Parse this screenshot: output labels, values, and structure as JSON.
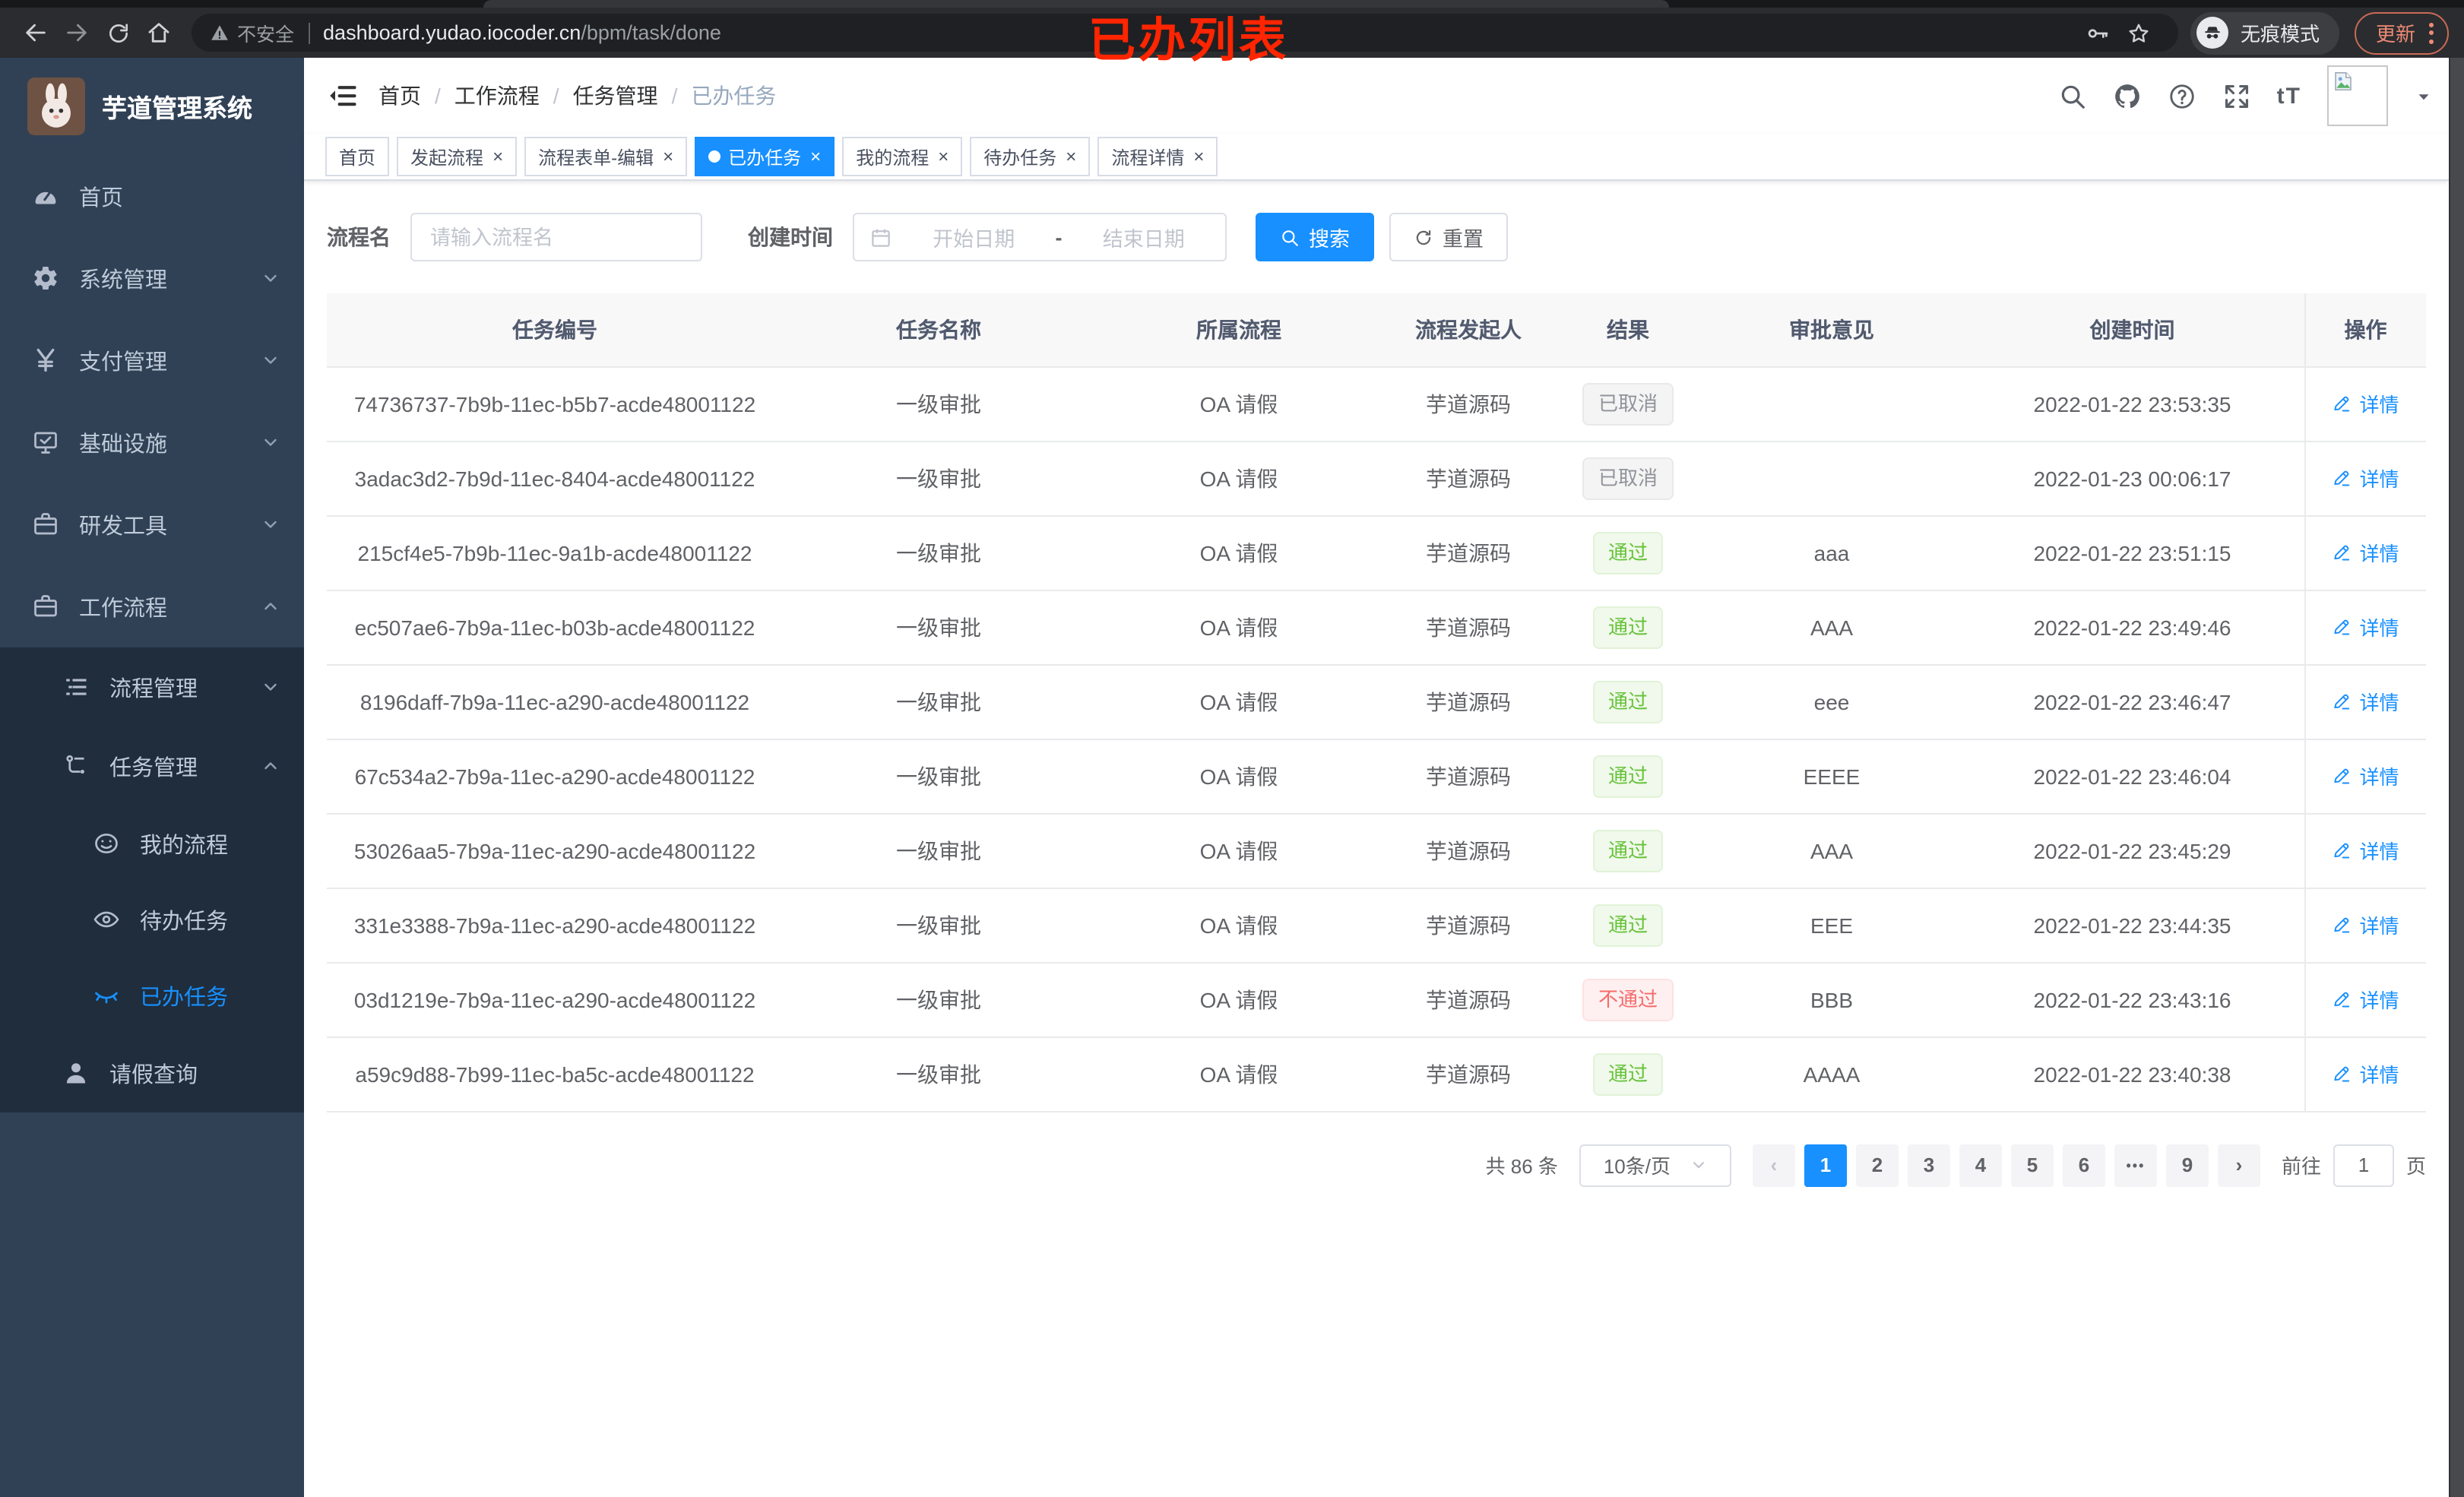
{
  "colors": {
    "accent": "#1890ff",
    "success": "#67c23a",
    "danger": "#f56c6c",
    "info": "#909399",
    "sidebar_bg": "#304156",
    "submenu_bg": "#1f2d3d",
    "annotation_red": "#fe2500"
  },
  "browser": {
    "annotation": "已办列表",
    "security_label": "不安全",
    "url_domain": "dashboard.yudao.iocoder.cn",
    "url_path": "/bpm/task/done",
    "incognito_label": "无痕模式",
    "update_label": "更新"
  },
  "sidebar": {
    "app_title": "芋道管理系统",
    "items": {
      "home": "首页",
      "system": "系统管理",
      "payment": "支付管理",
      "infra": "基础设施",
      "devtools": "研发工具",
      "workflow": "工作流程",
      "process_mgmt": "流程管理",
      "task_mgmt": "任务管理",
      "my_process": "我的流程",
      "todo_task": "待办任务",
      "done_task": "已办任务",
      "leave_query": "请假查询"
    }
  },
  "header": {
    "breadcrumb": [
      "首页",
      "工作流程",
      "任务管理",
      "已办任务"
    ],
    "separator": "/",
    "font_size_icon_label": "tT"
  },
  "tabs": {
    "close_glyph": "×",
    "items": [
      {
        "label": "首页"
      },
      {
        "label": "发起流程"
      },
      {
        "label": "流程表单-编辑"
      },
      {
        "label": "已办任务",
        "active": true
      },
      {
        "label": "我的流程"
      },
      {
        "label": "待办任务"
      },
      {
        "label": "流程详情"
      }
    ]
  },
  "filters": {
    "name_label": "流程名",
    "name_placeholder": "请输入流程名",
    "date_label": "创建时间",
    "date_start_placeholder": "开始日期",
    "date_separator": "-",
    "date_end_placeholder": "结束日期",
    "search_label": "搜索",
    "reset_label": "重置"
  },
  "table": {
    "columns": [
      "任务编号",
      "任务名称",
      "所属流程",
      "流程发起人",
      "结果",
      "审批意见",
      "创建时间",
      "操作"
    ],
    "rows": [
      {
        "id": "74736737-7b9b-11ec-b5b7-acde48001122",
        "name": "一级审批",
        "process": "OA 请假",
        "starter": "芋道源码",
        "result": "已取消",
        "result_type": "info",
        "opinion": "",
        "created": "2022-01-22 23:53:35",
        "action": "详情"
      },
      {
        "id": "3adac3d2-7b9d-11ec-8404-acde48001122",
        "name": "一级审批",
        "process": "OA 请假",
        "starter": "芋道源码",
        "result": "已取消",
        "result_type": "info",
        "opinion": "",
        "created": "2022-01-23 00:06:17",
        "action": "详情"
      },
      {
        "id": "215cf4e5-7b9b-11ec-9a1b-acde48001122",
        "name": "一级审批",
        "process": "OA 请假",
        "starter": "芋道源码",
        "result": "通过",
        "result_type": "success",
        "opinion": "aaa",
        "created": "2022-01-22 23:51:15",
        "action": "详情"
      },
      {
        "id": "ec507ae6-7b9a-11ec-b03b-acde48001122",
        "name": "一级审批",
        "process": "OA 请假",
        "starter": "芋道源码",
        "result": "通过",
        "result_type": "success",
        "opinion": "AAA",
        "created": "2022-01-22 23:49:46",
        "action": "详情"
      },
      {
        "id": "8196daff-7b9a-11ec-a290-acde48001122",
        "name": "一级审批",
        "process": "OA 请假",
        "starter": "芋道源码",
        "result": "通过",
        "result_type": "success",
        "opinion": "eee",
        "created": "2022-01-22 23:46:47",
        "action": "详情"
      },
      {
        "id": "67c534a2-7b9a-11ec-a290-acde48001122",
        "name": "一级审批",
        "process": "OA 请假",
        "starter": "芋道源码",
        "result": "通过",
        "result_type": "success",
        "opinion": "EEEE",
        "created": "2022-01-22 23:46:04",
        "action": "详情"
      },
      {
        "id": "53026aa5-7b9a-11ec-a290-acde48001122",
        "name": "一级审批",
        "process": "OA 请假",
        "starter": "芋道源码",
        "result": "通过",
        "result_type": "success",
        "opinion": "AAA",
        "created": "2022-01-22 23:45:29",
        "action": "详情"
      },
      {
        "id": "331e3388-7b9a-11ec-a290-acde48001122",
        "name": "一级审批",
        "process": "OA 请假",
        "starter": "芋道源码",
        "result": "通过",
        "result_type": "success",
        "opinion": "EEE",
        "created": "2022-01-22 23:44:35",
        "action": "详情"
      },
      {
        "id": "03d1219e-7b9a-11ec-a290-acde48001122",
        "name": "一级审批",
        "process": "OA 请假",
        "starter": "芋道源码",
        "result": "不通过",
        "result_type": "danger",
        "opinion": "BBB",
        "created": "2022-01-22 23:43:16",
        "action": "详情"
      },
      {
        "id": "a59c9d88-7b99-11ec-ba5c-acde48001122",
        "name": "一级审批",
        "process": "OA 请假",
        "starter": "芋道源码",
        "result": "通过",
        "result_type": "success",
        "opinion": "AAAA",
        "created": "2022-01-22 23:40:38",
        "action": "详情"
      }
    ]
  },
  "pagination": {
    "total": "共 86 条",
    "page_size": "10条/页",
    "prev": "‹",
    "next": "›",
    "pages": [
      "1",
      "2",
      "3",
      "4",
      "5",
      "6",
      "•••",
      "9"
    ],
    "active_page": "1",
    "goto_label": "前往",
    "goto_value": "1",
    "page_unit": "页"
  }
}
